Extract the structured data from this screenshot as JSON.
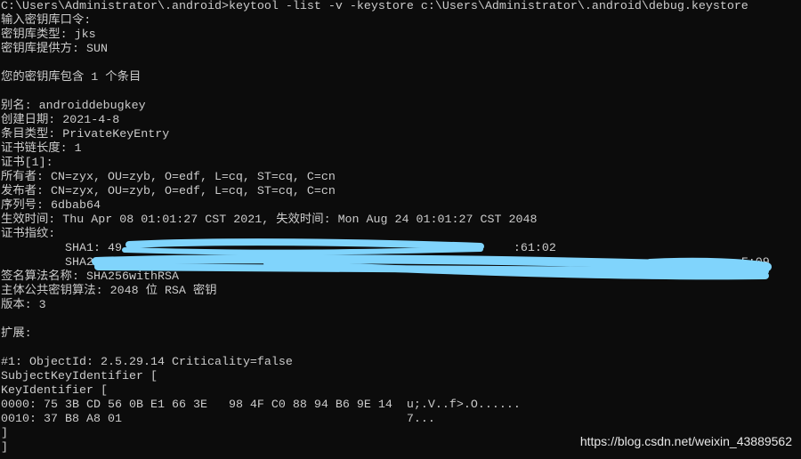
{
  "terminal": {
    "lines": [
      "C:\\Users\\Administrator\\.android>keytool -list -v -keystore c:\\Users\\Administrator\\.android\\debug.keystore",
      "输入密钥库口令:",
      "密钥库类型: jks",
      "密钥库提供方: SUN",
      "",
      "您的密钥库包含 1 个条目",
      "",
      "别名: androiddebugkey",
      "创建日期: 2021-4-8",
      "条目类型: PrivateKeyEntry",
      "证书链长度: 1",
      "证书[1]:",
      "所有者: CN=zyx, OU=zyb, O=edf, L=cq, ST=cq, C=cn",
      "发布者: CN=zyx, OU=zyb, O=edf, L=cq, ST=cq, C=cn",
      "序列号: 6dbab64",
      "生效时间: Thu Apr 08 01:01:27 CST 2021, 失效时间: Mon Aug 24 01:01:27 CST 2048",
      "证书指纹:",
      "         SHA1: 49                                                       :61:02",
      "         SHA256: 52:12                                                                                  F:09",
      "签名算法名称: SHA256withRSA",
      "主体公共密钥算法: 2048 位 RSA 密钥",
      "版本: 3",
      "",
      "扩展:",
      "",
      "#1: ObjectId: 2.5.29.14 Criticality=false",
      "SubjectKeyIdentifier [",
      "KeyIdentifier [",
      "0000: 75 3B CD 56 0B E1 66 3E   98 4F C0 88 94 B6 9E 14  u;.V..f>.O......",
      "0010: 37 B8 A8 01                                        7...",
      "]",
      "]"
    ]
  },
  "watermark": "https://blog.csdn.net/weixin_43889562",
  "colors": {
    "background": "#0c0c0c",
    "text": "#cccccc",
    "redaction": "#80d4fc"
  }
}
